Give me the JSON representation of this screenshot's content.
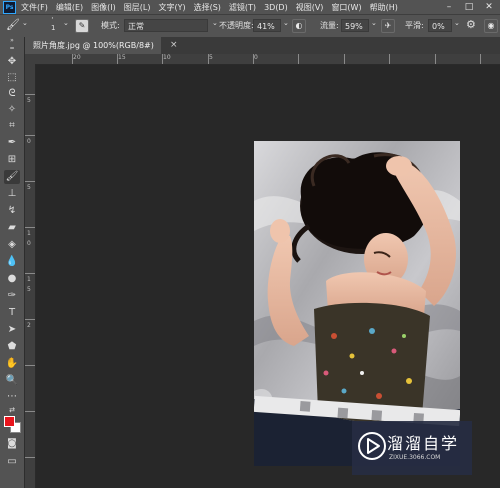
{
  "app": {
    "logo_text": "Ps",
    "minimize_glyph": "–",
    "maximize_glyph": "□",
    "close_glyph": "✕"
  },
  "menu": [
    "文件(F)",
    "编辑(E)",
    "图像(I)",
    "图层(L)",
    "文字(Y)",
    "选择(S)",
    "滤镜(T)",
    "3D(D)",
    "视图(V)",
    "窗口(W)",
    "帮助(H)"
  ],
  "options": {
    "brush_size": "1",
    "mode_label": "模式:",
    "mode_value": "正常",
    "opacity_label": "不透明度:",
    "opacity_value": "41%",
    "flow_label": "流量:",
    "flow_value": "59%",
    "smoothing_label": "平滑:",
    "smoothing_value": "0%"
  },
  "document": {
    "tab_title": "照片角度.jpg @ 100%(RGB/8#)",
    "close_glyph": "×"
  },
  "ruler": {
    "top_numbers": [
      "20",
      "15",
      "10",
      "5",
      "0"
    ],
    "left_numbers": [
      "5",
      "0",
      "5",
      "1",
      "0",
      "1",
      "5",
      "2"
    ]
  },
  "colors": {
    "foreground": "#e8141c",
    "background": "#ffffff",
    "ui_panel": "#535353",
    "workspace": "#282828"
  },
  "icons": [
    "move-icon",
    "marquee-icon",
    "lasso-icon",
    "quick-select-icon",
    "crop-icon",
    "eyedropper-icon",
    "healing-icon",
    "brush-icon",
    "stamp-icon",
    "history-brush-icon",
    "eraser-icon",
    "paint-bucket-icon",
    "blur-icon",
    "dodge-icon",
    "pen-icon",
    "type-icon",
    "path-select-icon",
    "shape-icon",
    "hand-icon",
    "zoom-icon",
    "more-icon",
    "edit-toolbar-icon",
    "screen-mode-icon"
  ],
  "watermark": {
    "title": "溜溜自学",
    "url": "ZIXUE.3066.COM"
  }
}
